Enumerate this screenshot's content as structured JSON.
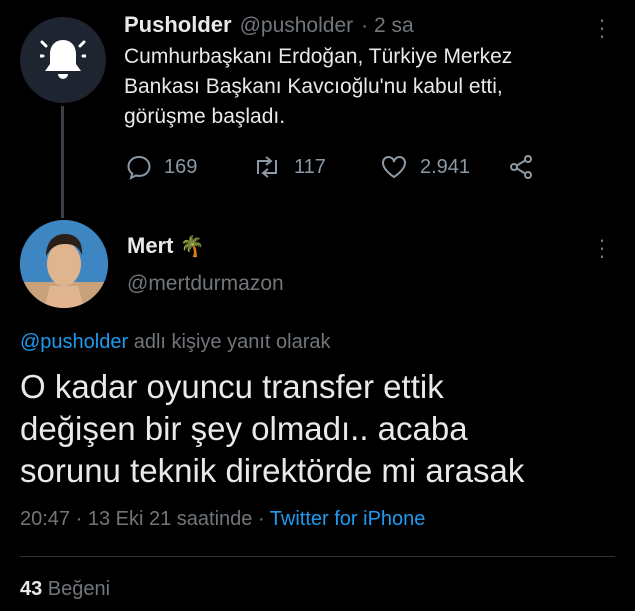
{
  "parent": {
    "name": "Pusholder",
    "handle": "@pusholder",
    "time": "· 2 sa",
    "text_line1": "Cumhurbaşkanı Erdoğan, Türkiye Merkez",
    "text_line2": "Bankası Başkanı Kavcıoğlu'nu kabul etti,",
    "text_line3": "görüşme başladı.",
    "replies": "169",
    "retweets": "117",
    "likes": "2.941"
  },
  "reply": {
    "name": "Mert",
    "emoji": "🌴",
    "handle": "@mertdurmazon",
    "replying_mention": "@pusholder",
    "replying_suffix": " adlı kişiye yanıt olarak",
    "text_line1": "O kadar oyuncu transfer ettik",
    "text_line2": "değişen bir şey olmadı.. acaba",
    "text_line3": "sorunu teknik direktörde mi arasak",
    "timestamp": "20:47 · 13 Eki 21 saatinde · ",
    "source": "Twitter for iPhone",
    "like_count": "43",
    "like_label": " Beğeni"
  },
  "colors": {
    "accent": "#1d9bf0",
    "muted": "#71767b",
    "background": "#000000"
  }
}
